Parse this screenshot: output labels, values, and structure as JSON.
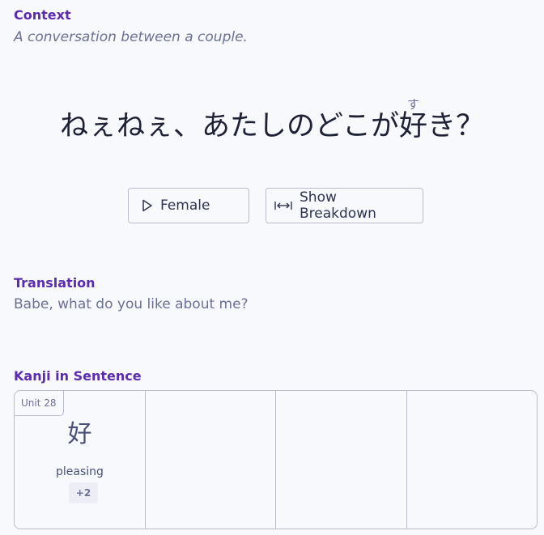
{
  "context": {
    "heading": "Context",
    "text": "A conversation between a couple."
  },
  "sentence": {
    "before": "ねぇねぇ、あたしのどこが",
    "kanji": "好",
    "furigana": "す",
    "after": "き？"
  },
  "buttons": {
    "play_icon": "play-icon",
    "play_label": "Female",
    "breakdown_icon": "expand-horizontal-icon",
    "breakdown_label": "Show Breakdown"
  },
  "translation": {
    "heading": "Translation",
    "text": "Babe, what do you like about me?"
  },
  "kanji_section": {
    "heading": "Kanji in Sentence",
    "cards": [
      {
        "unit": "Unit 28",
        "character": "好",
        "meaning": "pleasing",
        "extra": "+2"
      }
    ]
  },
  "colors": {
    "heading": "#5b2bb0",
    "muted_text": "#6d7096",
    "sentence_text": "#1f2236",
    "border": "#b9bccf",
    "background": "#f8f9fc"
  }
}
